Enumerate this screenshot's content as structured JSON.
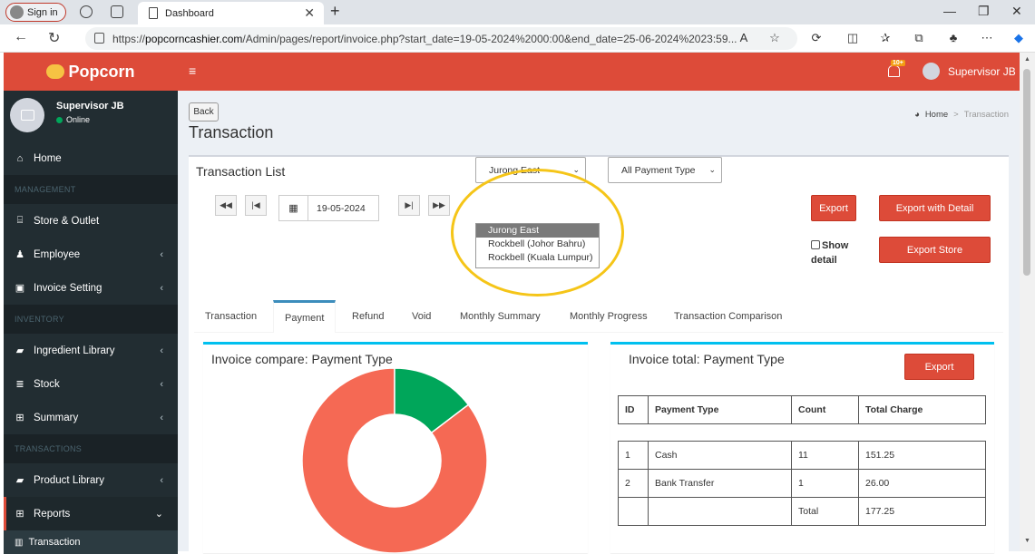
{
  "browser": {
    "signin_label": "Sign in",
    "tab_title": "Dashboard",
    "url_prefix": "https://",
    "url_host": "popcorncashier.com",
    "url_path": "/Admin/pages/report/invoice.php?start_date=19-05-2024%2000:00&end_date=25-06-2024%2023:59..."
  },
  "app": {
    "logo_text": "Popcorn",
    "user_name": "Supervisor JB",
    "user_status": "Online",
    "notification_badge": "10+",
    "brand_color": "#dd4b39",
    "sidebar_color": "#222d32"
  },
  "sidebar": {
    "home": "Home",
    "management_header": "MANAGEMENT",
    "store_outlet": "Store & Outlet",
    "employee": "Employee",
    "invoice_setting": "Invoice Setting",
    "inventory_header": "INVENTORY",
    "ingredient_library": "Ingredient Library",
    "stock": "Stock",
    "summary": "Summary",
    "transactions_header": "TRANSACTIONS",
    "product_library": "Product Library",
    "reports": "Reports",
    "transaction": "Transaction"
  },
  "header": {
    "back_label": "Back",
    "page_title": "Transaction",
    "breadcrumb_home": "Home",
    "breadcrumb_sep": ">",
    "breadcrumb_current": "Transaction"
  },
  "filters": {
    "list_title": "Transaction List",
    "date_value": "19-05-2024",
    "outlet_selected": "Jurong East",
    "outlet_options": [
      "Jurong East",
      "Rockbell (Johor Bahru)",
      "Rockbell (Kuala Lumpur)"
    ],
    "payment_selected": "All Payment Type",
    "export_label": "Export",
    "export_detail_label": "Export with Detail",
    "export_store_label": "Export Store",
    "show_label": "Show",
    "detail_label": "detail"
  },
  "tabs": [
    "Transaction",
    "Payment",
    "Refund",
    "Void",
    "Monthly Summary",
    "Monthly Progress",
    "Transaction Comparison"
  ],
  "compare_card": {
    "title": "Invoice compare: Payment Type",
    "colors": [
      "#f56954",
      "#00a65a"
    ]
  },
  "total_card": {
    "title": "Invoice total: Payment Type",
    "export_label": "Export",
    "headers": [
      "ID",
      "Payment Type",
      "Count",
      "Total Charge"
    ],
    "rows": [
      [
        "1",
        "Cash",
        "11",
        "151.25"
      ],
      [
        "2",
        "Bank Transfer",
        "1",
        "26.00"
      ]
    ],
    "total_label": "Total",
    "total_value": "177.25"
  },
  "chart_data": {
    "type": "pie",
    "categories": [
      "Cash",
      "Bank Transfer"
    ],
    "values": [
      151.25,
      26.0
    ],
    "title": "Invoice compare: Payment Type"
  }
}
